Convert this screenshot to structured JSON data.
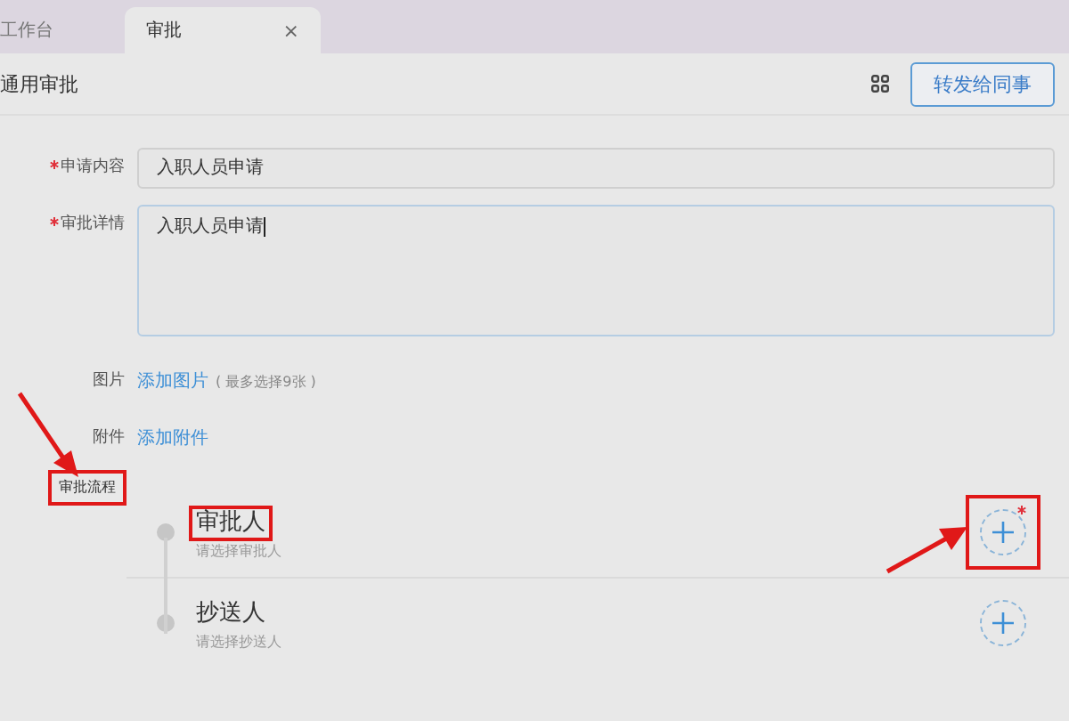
{
  "tabs": [
    {
      "label": "工作台",
      "selected": false
    },
    {
      "label": "审批",
      "selected": true,
      "close": "×"
    }
  ],
  "header": {
    "title": "通用审批",
    "button": "转发给同事"
  },
  "fields": [
    {
      "label": "申请内容",
      "required": true,
      "value": "入职人员申请",
      "kind": "input",
      "focused": false
    },
    {
      "label": "审批详情",
      "required": true,
      "value": "入职人员申请",
      "kind": "textarea",
      "focused": true
    }
  ],
  "attachments": [
    {
      "label": "图片",
      "link": "添加图片",
      "hint": "( 最多选择9张 )"
    },
    {
      "label": "附件",
      "link": "添加附件"
    }
  ],
  "flow": {
    "label": "审批流程",
    "highlighted": true,
    "steps": [
      {
        "title": "审批人",
        "subtitle": "请选择审批人",
        "highlighted": true,
        "required": true
      },
      {
        "title": "抄送人",
        "subtitle": "请选择抄送人",
        "highlighted": false,
        "required": false
      }
    ]
  }
}
